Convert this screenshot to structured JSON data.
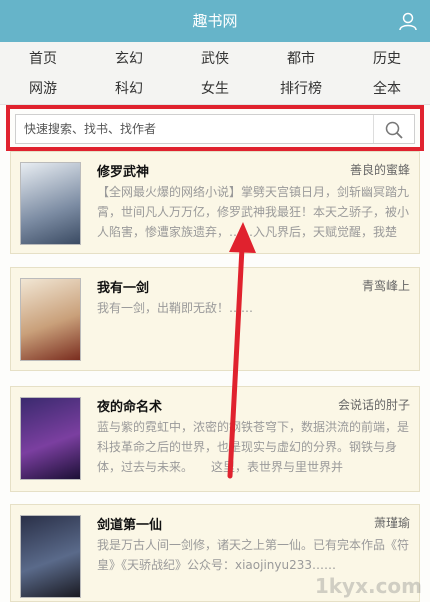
{
  "header": {
    "title": "趣书网",
    "user_icon": "user-icon"
  },
  "nav": {
    "row1": [
      "首页",
      "玄幻",
      "武侠",
      "都市",
      "历史"
    ],
    "row2": [
      "网游",
      "科幻",
      "女生",
      "排行榜",
      "全本"
    ]
  },
  "search": {
    "placeholder": "快速搜索、找书、找作者",
    "icon": "search-icon"
  },
  "books": [
    {
      "title": "修罗武神",
      "author": "善良的蜜蜂",
      "desc": "【全网最火爆的网络小说】掌劈天宫镇日月，剑斩幽冥踏九霄，世间凡人万万亿，修罗武神我最狂！本天之骄子，被小人陷害，惨遭家族遗弃，……入凡界后，天赋觉醒，我楚"
    },
    {
      "title": "我有一剑",
      "author": "青鸾峰上",
      "desc": "我有一剑，出鞘即无敌！……"
    },
    {
      "title": "夜的命名术",
      "author": "会说话的肘子",
      "desc": "蓝与紫的霓虹中，浓密的钢铁苍穹下，数据洪流的前端，是科技革命之后的世界，也是现实与虚幻的分界。钢铁与身体，过去与未来。　　这里，表世界与里世界并"
    },
    {
      "title": "剑道第一仙",
      "author": "萧瑾瑜",
      "desc": "我是万古人间一剑修，诸天之上第一仙。已有完本作品《符皇》《天骄战纪》公众号：xiaojinyu233……"
    }
  ],
  "watermark": "1kyx.com",
  "colors": {
    "header": "#66b4c9",
    "highlight": "#e0222e",
    "card_bg": "#fbf7e6"
  }
}
